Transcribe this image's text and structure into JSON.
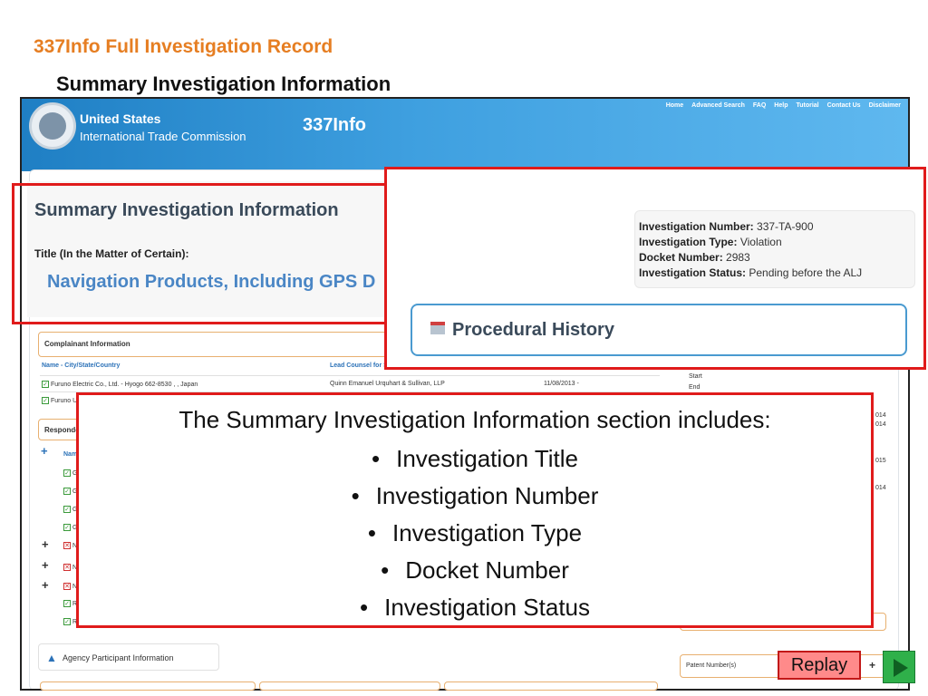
{
  "slide": {
    "title": "337Info Full Investigation Record",
    "subtitle": "Summary Investigation Information"
  },
  "site": {
    "agency_line1": "United States",
    "agency_line2": "International Trade Commission",
    "app_name": "337Info",
    "nav": [
      "Home",
      "Advanced Search",
      "FAQ",
      "Help",
      "Tutorial",
      "Contact Us",
      "Disclaimer"
    ]
  },
  "summary": {
    "heading": "Summary Investigation Information",
    "title_label": "Title (In the Matter of Certain):",
    "title_value": "Navigation Products, Including GPS D"
  },
  "investigation": {
    "number_label": "Investigation Number:",
    "number": "337-TA-900",
    "type_label": "Investigation Type:",
    "type": "Violation",
    "docket_label": "Docket Number:",
    "docket": "2983",
    "status_label": "Investigation Status:",
    "status": "Pending before the ALJ"
  },
  "procedural": {
    "heading": "Procedural History"
  },
  "complainant": {
    "heading": "Complainant Information",
    "col_name": "Name - City/State/Country",
    "col_counsel": "Lead Counsel for Se",
    "row1_name": "Furuno Electric Co., Ltd. - Hyogo 662-8530 , , Japan",
    "row1_counsel": "Quinn Emanuel Urquhart & Sullivan, LLP",
    "row1_date": "11/08/2013 -",
    "row2_name": "Furuno U.S"
  },
  "respondents": {
    "heading": "Responde",
    "col_name": "Nam",
    "rows": [
      "G",
      "G",
      "G",
      "G",
      "N",
      "N",
      "N",
      "R",
      "R"
    ]
  },
  "right_column": {
    "start": "Start",
    "end": "End",
    "frag1": "014",
    "frag2": "014",
    "frag3": "015",
    "frag4": "014"
  },
  "agency": {
    "heading": "Agency Participant Information"
  },
  "patent": {
    "heading": "Patent Number(s)",
    "plus": "+"
  },
  "callout": {
    "intro": "The Summary Investigation Information section includes:",
    "items": [
      "Investigation Title",
      "Investigation Number",
      "Investigation Type",
      "Docket Number",
      "Investigation Status"
    ]
  },
  "controls": {
    "replay_label": "Replay"
  },
  "colors": {
    "slide_title": "#e67e22",
    "callout_border": "#e01b1b",
    "banner": "#2f8fd4",
    "replay_bg": "#ff8a8a",
    "play_bg": "#2fb04a"
  }
}
